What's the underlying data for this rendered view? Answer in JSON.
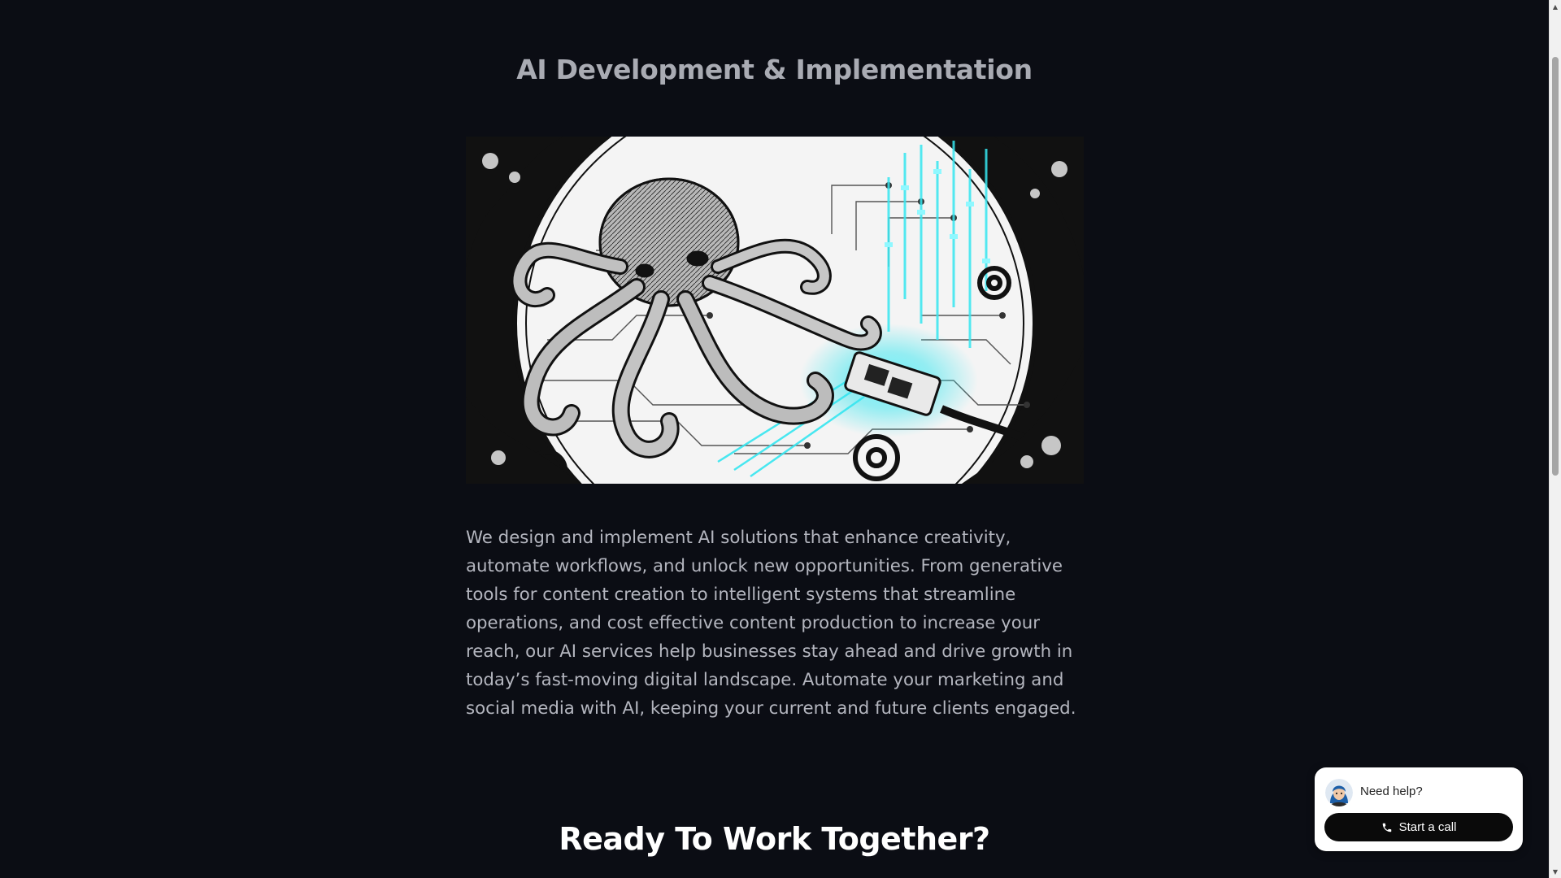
{
  "section": {
    "title": "AI Development & Implementation",
    "image_alt": "Illustration of an octopus on a circuit board plugging in a glowing connector",
    "body": "We design and implement AI solutions that enhance creativity, automate workflows, and unlock new opportunities. From generative tools for content creation to intelligent systems that streamline operations, and cost effective content production to increase your reach, our AI services help businesses stay ahead and drive growth in today’s fast-moving digital landscape. Automate your marketing and social media with AI, keeping your current and future clients engaged."
  },
  "cta": {
    "title": "Ready To Work Together?"
  },
  "help_widget": {
    "prompt": "Need help?",
    "call_label": "Start a call",
    "icons": {
      "avatar": "agent-avatar",
      "call": "phone-icon"
    }
  },
  "colors": {
    "background": "#0b0d14",
    "title": "#a9abb3",
    "body_text": "#b4b6bf",
    "accent_glow": "#36e6f0",
    "button": "#0a0a0a"
  }
}
